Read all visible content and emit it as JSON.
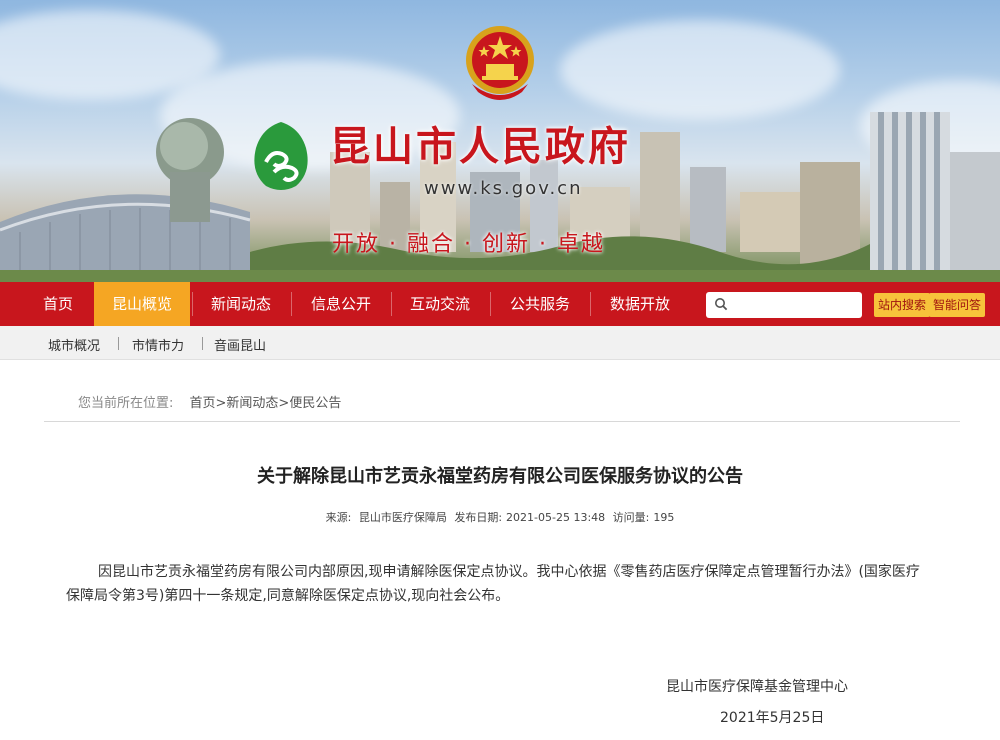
{
  "header": {
    "site_title": "昆山市人民政府",
    "site_url": "www.ks.gov.cn",
    "slogan": "开放 · 融合 · 创新 · 卓越"
  },
  "nav": {
    "items": [
      {
        "label": "首页",
        "active": false
      },
      {
        "label": "昆山概览",
        "active": true
      },
      {
        "label": "新闻动态",
        "active": false
      },
      {
        "label": "信息公开",
        "active": false
      },
      {
        "label": "互动交流",
        "active": false
      },
      {
        "label": "公共服务",
        "active": false
      },
      {
        "label": "数据开放",
        "active": false
      }
    ],
    "search_placeholder": "",
    "site_search_label": "站内搜索",
    "smart_qa_label": "智能问答"
  },
  "subnav": {
    "items": [
      "城市概况",
      "市情市力",
      "音画昆山"
    ]
  },
  "breadcrumb": {
    "prefix": "您当前所在位置:",
    "path": "首页>新闻动态>便民公告"
  },
  "article": {
    "title": "关于解除昆山市艺贡永福堂药房有限公司医保服务协议的公告",
    "meta": {
      "source_label": "来源:",
      "source": "昆山市医疗保障局",
      "date_label": "发布日期:",
      "date": "2021-05-25 13:48",
      "views_label": "访问量:",
      "views": "195"
    },
    "body": "因昆山市艺贡永福堂药房有限公司内部原因,现申请解除医保定点协议。我中心依据《零售药店医疗保障定点管理暂行办法》(国家医疗保障局令第3号)第四十一条规定,同意解除医保定点协议,现向社会公布。",
    "signature": "昆山市医疗保障基金管理中心",
    "sign_date": "2021年5月25日"
  },
  "colors": {
    "brand_red": "#c8161d",
    "active_tab": "#f5a623",
    "button_yellow": "#f7c33b"
  },
  "icons": [
    "national-emblem-icon",
    "kunshan-logo-icon",
    "search-icon"
  ]
}
